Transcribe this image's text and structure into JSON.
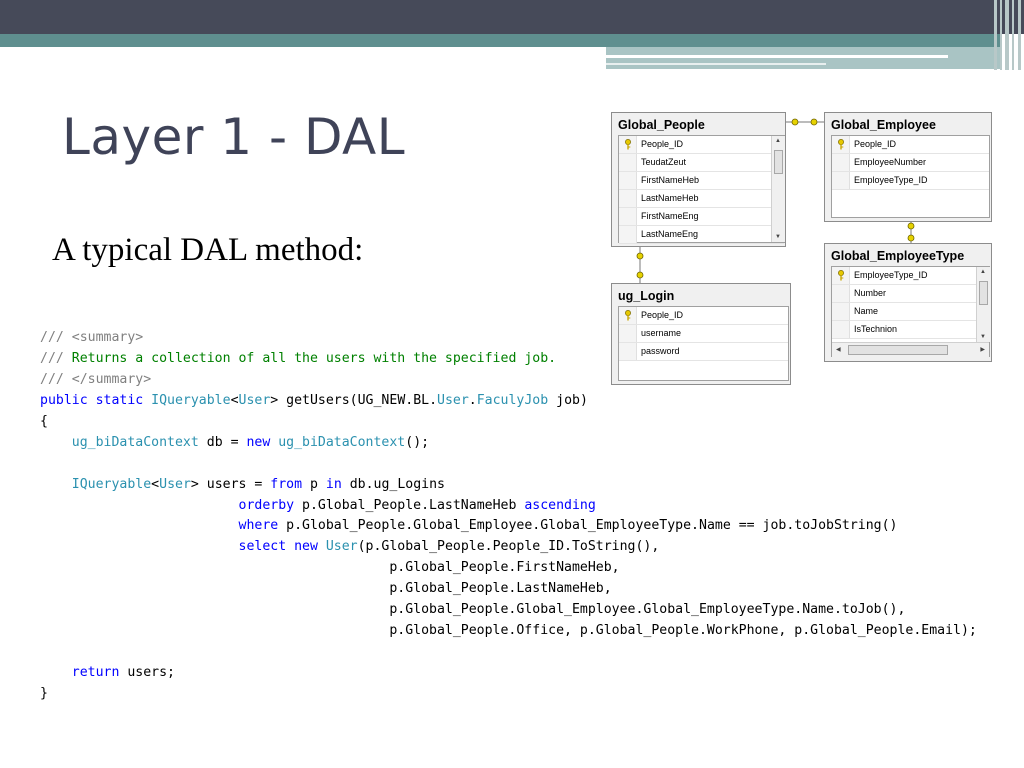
{
  "slide": {
    "title": "Layer 1 - DAL",
    "subtitle": "A typical DAL method:"
  },
  "code": [
    {
      "parts": [
        {
          "c": "cmg",
          "t": "/// "
        },
        {
          "c": "cmg",
          "t": "<summary>"
        }
      ]
    },
    {
      "parts": [
        {
          "c": "cmg",
          "t": "/// "
        },
        {
          "c": "cm",
          "t": "Returns a collection of all the users with the specified job."
        }
      ]
    },
    {
      "parts": [
        {
          "c": "cmg",
          "t": "/// "
        },
        {
          "c": "cmg",
          "t": "</summary>"
        }
      ]
    },
    {
      "parts": [
        {
          "c": "kw",
          "t": "public static "
        },
        {
          "c": "ty",
          "t": "IQueryable"
        },
        {
          "c": "",
          "t": "<"
        },
        {
          "c": "ty",
          "t": "User"
        },
        {
          "c": "",
          "t": "> getUsers(UG_NEW.BL."
        },
        {
          "c": "ty",
          "t": "User"
        },
        {
          "c": "",
          "t": "."
        },
        {
          "c": "ty",
          "t": "FaculyJob"
        },
        {
          "c": "",
          "t": " job)"
        }
      ]
    },
    {
      "parts": [
        {
          "c": "",
          "t": "{"
        }
      ]
    },
    {
      "parts": [
        {
          "c": "",
          "t": "    "
        },
        {
          "c": "ty",
          "t": "ug_biDataContext"
        },
        {
          "c": "",
          "t": " db = "
        },
        {
          "c": "kw",
          "t": "new "
        },
        {
          "c": "ty",
          "t": "ug_biDataContext"
        },
        {
          "c": "",
          "t": "();"
        }
      ]
    },
    {
      "parts": [
        {
          "c": "",
          "t": ""
        }
      ]
    },
    {
      "parts": [
        {
          "c": "",
          "t": "    "
        },
        {
          "c": "ty",
          "t": "IQueryable"
        },
        {
          "c": "",
          "t": "<"
        },
        {
          "c": "ty",
          "t": "User"
        },
        {
          "c": "",
          "t": "> users = "
        },
        {
          "c": "kw",
          "t": "from"
        },
        {
          "c": "",
          "t": " p "
        },
        {
          "c": "kw",
          "t": "in"
        },
        {
          "c": "",
          "t": " db.ug_Logins"
        }
      ]
    },
    {
      "parts": [
        {
          "c": "",
          "t": "                         "
        },
        {
          "c": "kw",
          "t": "orderby"
        },
        {
          "c": "",
          "t": " p.Global_People.LastNameHeb "
        },
        {
          "c": "kw",
          "t": "ascending"
        }
      ]
    },
    {
      "parts": [
        {
          "c": "",
          "t": "                         "
        },
        {
          "c": "kw",
          "t": "where"
        },
        {
          "c": "",
          "t": " p.Global_People.Global_Employee.Global_EmployeeType.Name == job.toJobString()"
        }
      ]
    },
    {
      "parts": [
        {
          "c": "",
          "t": "                         "
        },
        {
          "c": "kw",
          "t": "select new "
        },
        {
          "c": "ty",
          "t": "User"
        },
        {
          "c": "",
          "t": "(p.Global_People.People_ID.ToString(),"
        }
      ]
    },
    {
      "parts": [
        {
          "c": "",
          "t": "                                            p.Global_People.FirstNameHeb,"
        }
      ]
    },
    {
      "parts": [
        {
          "c": "",
          "t": "                                            p.Global_People.LastNameHeb,"
        }
      ]
    },
    {
      "parts": [
        {
          "c": "",
          "t": "                                            p.Global_People.Global_Employee.Global_EmployeeType.Name.toJob(),"
        }
      ]
    },
    {
      "parts": [
        {
          "c": "",
          "t": "                                            p.Global_People.Office, p.Global_People.WorkPhone, p.Global_People.Email);"
        }
      ]
    },
    {
      "parts": [
        {
          "c": "",
          "t": ""
        }
      ]
    },
    {
      "parts": [
        {
          "c": "",
          "t": "    "
        },
        {
          "c": "kw",
          "t": "return"
        },
        {
          "c": "",
          "t": " users;"
        }
      ]
    },
    {
      "parts": [
        {
          "c": "",
          "t": "}"
        }
      ]
    }
  ],
  "diagram": {
    "tables": [
      {
        "id": "global-people",
        "name": "Global_People",
        "columns": [
          "People_ID",
          "TeudatZeut",
          "FirstNameHeb",
          "LastNameHeb",
          "FirstNameEng",
          "LastNameEng"
        ],
        "key": [
          0
        ],
        "vscroll": true,
        "hscroll": false
      },
      {
        "id": "global-employee",
        "name": "Global_Employee",
        "columns": [
          "People_ID",
          "EmployeeNumber",
          "EmployeeType_ID"
        ],
        "key": [
          0
        ],
        "vscroll": false,
        "hscroll": false
      },
      {
        "id": "global-employeetype",
        "name": "Global_EmployeeType",
        "columns": [
          "EmployeeType_ID",
          "Number",
          "Name",
          "IsTechnion"
        ],
        "key": [
          0
        ],
        "vscroll": true,
        "hscroll": true
      },
      {
        "id": "ug-login",
        "name": "ug_Login",
        "columns": [
          "People_ID",
          "username",
          "password"
        ],
        "key": [
          0
        ],
        "vscroll": false,
        "hscroll": false
      }
    ]
  },
  "colors": {
    "topbar": "#464a59",
    "accent": "#5f8f8f",
    "title": "#3f4358",
    "comment": "#008000",
    "keyword": "#0000ff",
    "type": "#2b91af",
    "relationship": "#e6d200"
  }
}
